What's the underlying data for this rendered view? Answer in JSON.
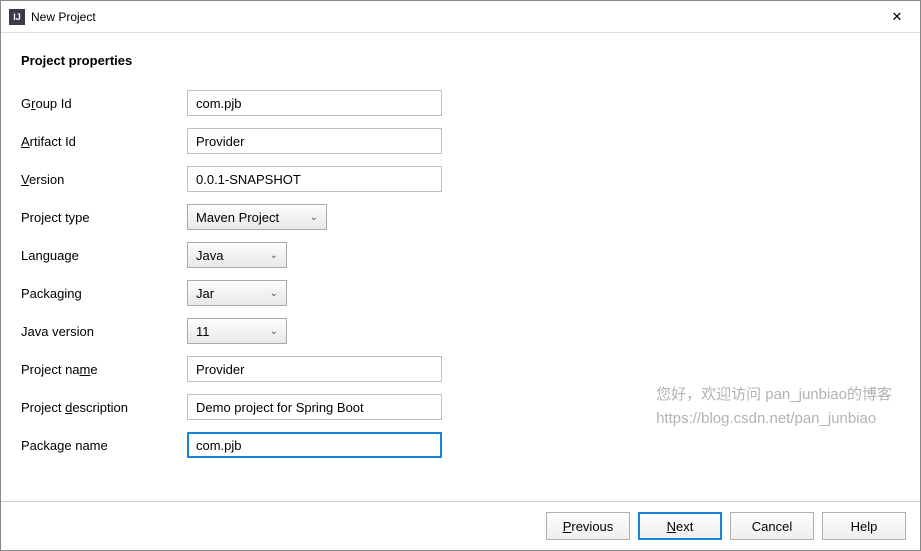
{
  "window": {
    "title": "New Project"
  },
  "section": {
    "title": "Project properties"
  },
  "form": {
    "groupId": {
      "label_pre": "G",
      "label_u": "r",
      "label_post": "oup Id",
      "value": "com.pjb"
    },
    "artifactId": {
      "label_pre": "",
      "label_u": "A",
      "label_post": "rtifact Id",
      "value": "Provider"
    },
    "version": {
      "label_pre": "",
      "label_u": "V",
      "label_post": "ersion",
      "value": "0.0.1-SNAPSHOT"
    },
    "projectType": {
      "label": "Project type",
      "value": "Maven Project"
    },
    "language": {
      "label": "Language",
      "value": "Java"
    },
    "packaging": {
      "label": "Packaging",
      "value": "Jar"
    },
    "javaVersion": {
      "label": "Java version",
      "value": "11"
    },
    "projectName": {
      "label_pre": "Project na",
      "label_u": "m",
      "label_post": "e",
      "value": "Provider"
    },
    "projectDescription": {
      "label_pre": "Project ",
      "label_u": "d",
      "label_post": "escription",
      "value": "Demo project for Spring Boot"
    },
    "packageName": {
      "label_pre": "Packa",
      "label_u": "g",
      "label_post": "e name",
      "value": "com.pjb"
    }
  },
  "watermark": {
    "line1": "您好，欢迎访问 pan_junbiao的博客",
    "line2": "https://blog.csdn.net/pan_junbiao"
  },
  "footer": {
    "previous": {
      "pre": "",
      "u": "P",
      "post": "revious"
    },
    "next": {
      "pre": "",
      "u": "N",
      "post": "ext"
    },
    "cancel": {
      "label": "Cancel"
    },
    "help": {
      "label": "Help"
    }
  }
}
